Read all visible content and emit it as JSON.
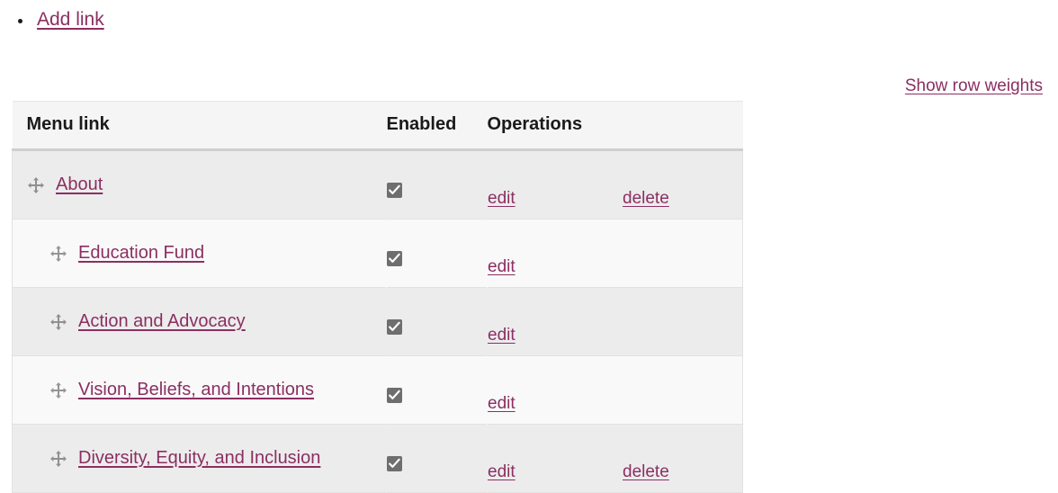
{
  "action_links": [
    {
      "label": "Add link",
      "icon": "bullet-dot"
    }
  ],
  "show_row_weights": {
    "label": "Show row weights"
  },
  "table": {
    "columns": [
      {
        "key": "menu_link",
        "label": "Menu link"
      },
      {
        "key": "enabled",
        "label": "Enabled"
      },
      {
        "key": "operations",
        "label": "Operations"
      }
    ],
    "rows": [
      {
        "menu_link": "About",
        "indent": 0,
        "enabled": true,
        "drag_icon": "move-cross-icon",
        "operations": [
          {
            "label": "edit",
            "name": "edit-link"
          },
          {
            "label": "delete",
            "name": "delete-link"
          }
        ]
      },
      {
        "menu_link": "Education Fund",
        "indent": 1,
        "enabled": true,
        "drag_icon": "move-cross-icon",
        "operations": [
          {
            "label": "edit",
            "name": "edit-link"
          }
        ]
      },
      {
        "menu_link": "Action and Advocacy",
        "indent": 1,
        "enabled": true,
        "drag_icon": "move-cross-icon",
        "operations": [
          {
            "label": "edit",
            "name": "edit-link"
          }
        ]
      },
      {
        "menu_link": "Vision, Beliefs, and Intentions",
        "indent": 1,
        "enabled": true,
        "drag_icon": "move-cross-icon",
        "operations": [
          {
            "label": "edit",
            "name": "edit-link"
          }
        ]
      },
      {
        "menu_link": "Diversity, Equity, and Inclusion",
        "indent": 1,
        "enabled": true,
        "drag_icon": "move-cross-icon",
        "operations": [
          {
            "label": "edit",
            "name": "edit-link"
          },
          {
            "label": "delete",
            "name": "delete-link"
          }
        ]
      }
    ]
  },
  "colors": {
    "link": "#8b2f62",
    "header_bg": "#f5f5f5",
    "row_odd_bg": "#ececec",
    "row_even_bg": "#f9f9f9",
    "checkbox_fill": "#6e6e6e",
    "text": "#1a1a1a"
  }
}
